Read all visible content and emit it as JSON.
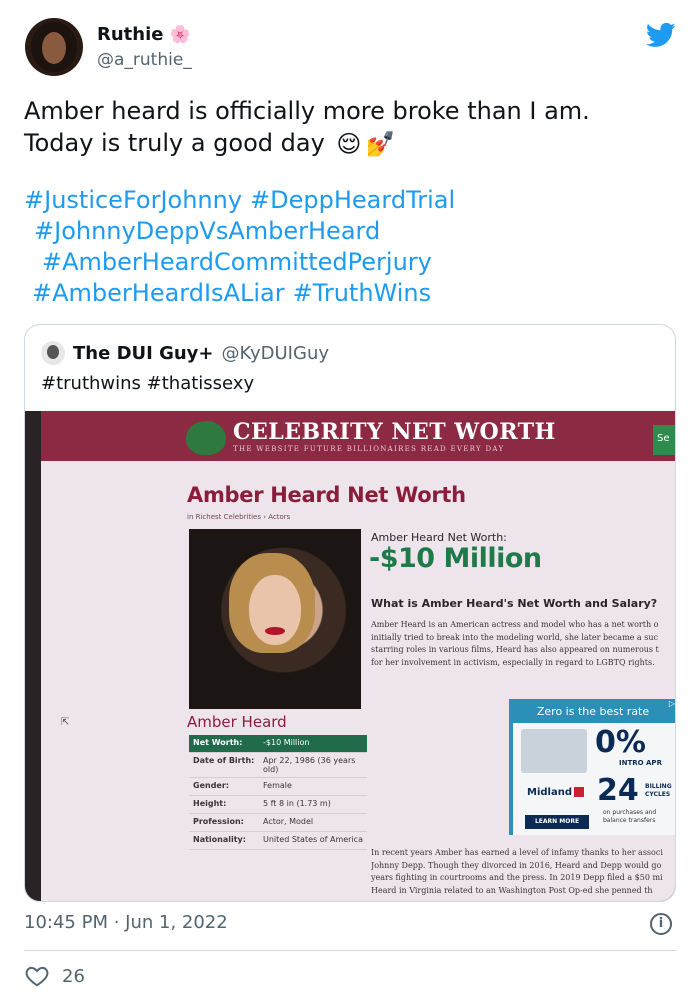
{
  "author": {
    "name": "Ruthie",
    "name_emoji": "🌸",
    "handle": "@a_ruthie_"
  },
  "tweet": {
    "line1": "Amber heard is officially more broke than I am.",
    "line2": "Today is truly a good day",
    "emoji1": "😌",
    "emoji2": "💅",
    "hashtag_lines": [
      [
        "#JusticeForJohnny",
        "#DeppHeardTrial"
      ],
      [
        "#JohnnyDeppVsAmberHeard"
      ],
      [
        "#AmberHeardCommittedPerjury"
      ],
      [
        "#AmberHeardIsALiar",
        "#TruthWins"
      ]
    ]
  },
  "quoted": {
    "name": "The DUI Guy+",
    "handle": "@KyDUIGuy",
    "text": "#truthwins #thatissexy",
    "image": {
      "site_name": "CELEBRITY NET WORTH",
      "tagline": "THE WEBSITE FUTURE BILLIONAIRES READ EVERY DAY",
      "search_fragment": "Se",
      "page_title": "Amber Heard Net Worth",
      "breadcrumb": "in Richest Celebrities › Actors",
      "net_worth_label": "Amber Heard Net Worth:",
      "net_worth_value": "-$10 Million",
      "question": "What is Amber Heard's Net Worth and Salary?",
      "bio_lines": [
        "Amber Heard is an American actress and model who has a net worth o",
        "initially tried to break into the modeling world, she later became a suc",
        "starring roles in various films, Heard has also appeared on numerous t",
        "for her involvement in activism, especially in regard to LGBTQ rights."
      ],
      "profile_name": "Amber Heard",
      "facts": [
        {
          "k": "Net Worth:",
          "v": "-$10 Million"
        },
        {
          "k": "Date of Birth:",
          "v": "Apr 22, 1986 (36 years old)"
        },
        {
          "k": "Gender:",
          "v": "Female"
        },
        {
          "k": "Height:",
          "v": "5 ft 8 in (1.73 m)"
        },
        {
          "k": "Profession:",
          "v": "Actor, Model"
        },
        {
          "k": "Nationality:",
          "v": "United States of America"
        }
      ],
      "bio2_lines": [
        "In recent years Amber has earned a level of infamy thanks to her associ",
        "Johnny Depp. Though they divorced in 2016, Heard and Depp would go",
        "years fighting in courtrooms and the press. In 2019 Depp filed a $50 mi",
        "Heard in Virginia related to an Washington Post Op-ed she penned th"
      ],
      "ad": {
        "title": "Zero is the best rate",
        "pct": "0%",
        "intro": "INTRO APR",
        "brand": "Midland",
        "cycles_num": "24",
        "cycles_label1": "BILLING",
        "cycles_label2": "CYCLES",
        "small1": "on purchases and",
        "small2": "balance transfers",
        "button": "LEARN MORE",
        "info": "▷"
      }
    }
  },
  "footer": {
    "timestamp": "10:45 PM · Jun 1, 2022",
    "info_icon": "i",
    "likes": "26"
  },
  "colors": {
    "link": "#1d9bf0",
    "muted": "#536471",
    "twitter_blue": "#1d9bf0"
  }
}
